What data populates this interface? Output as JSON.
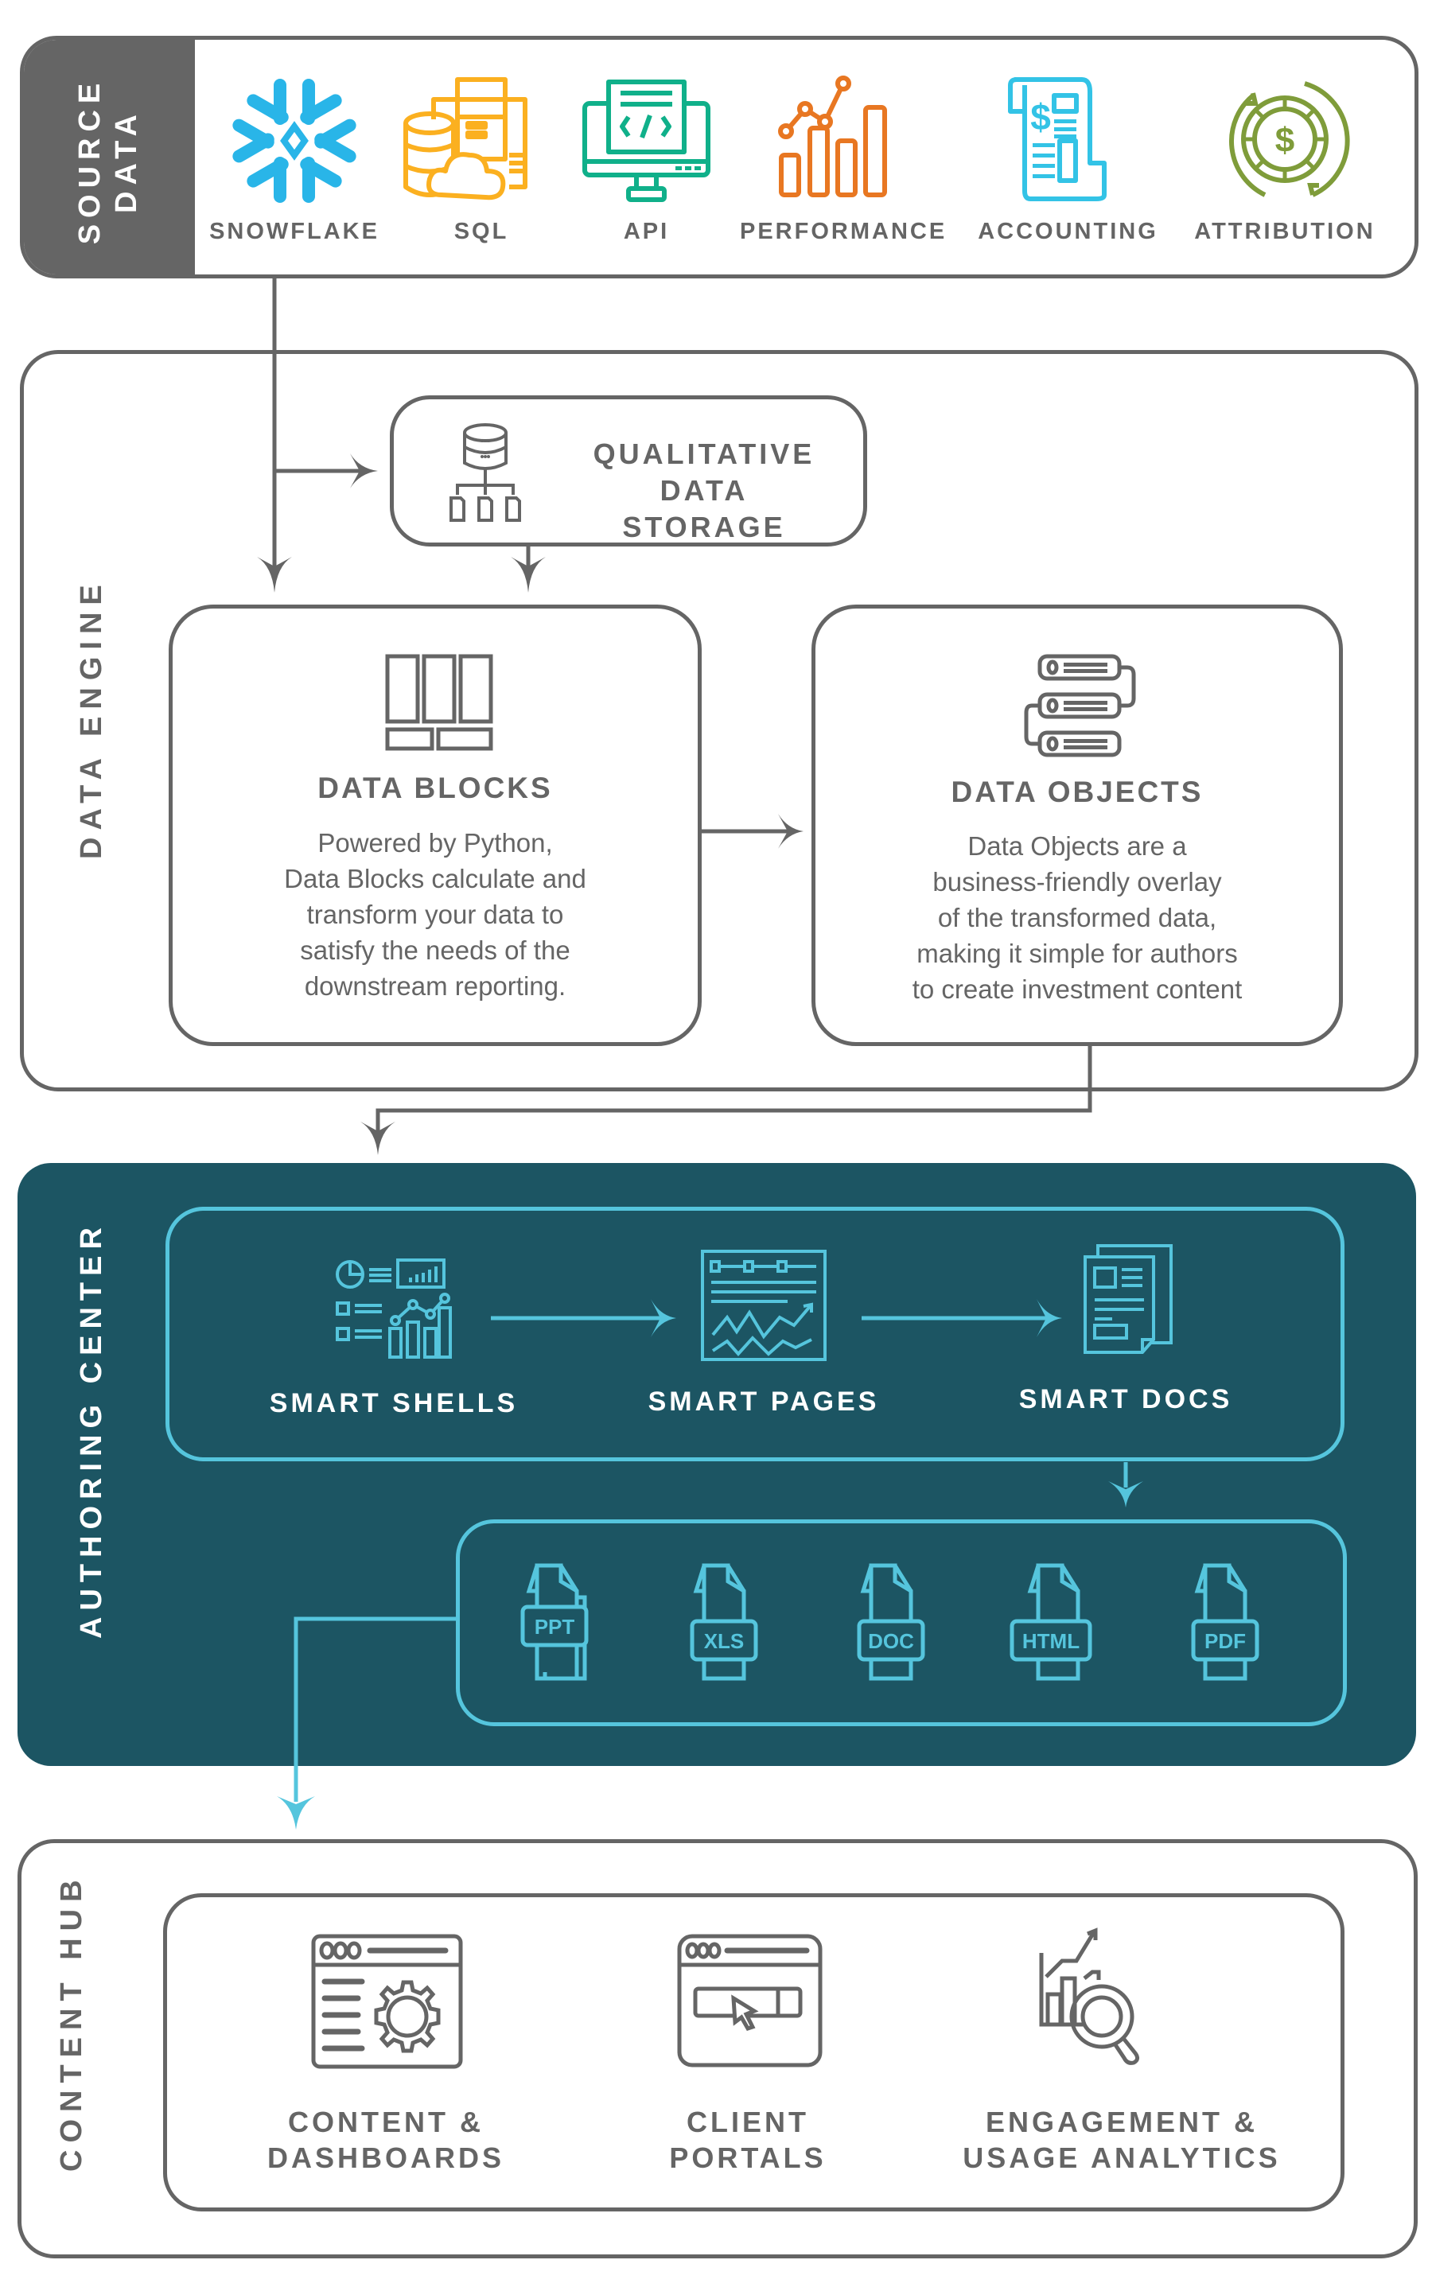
{
  "source_data": {
    "section_label_line1": "SOURCE",
    "section_label_line2": "DATA",
    "items": [
      {
        "label": "SNOWFLAKE",
        "icon": "snowflake-icon",
        "color": "#29b5e8"
      },
      {
        "label": "SQL",
        "icon": "database-cloud-icon",
        "color": "#fbb020"
      },
      {
        "label": "API",
        "icon": "monitor-code-icon",
        "color": "#10b08a"
      },
      {
        "label": "PERFORMANCE",
        "icon": "bar-line-chart-icon",
        "color": "#e87722"
      },
      {
        "label": "ACCOUNTING",
        "icon": "ledger-dollar-icon",
        "color": "#33c3e6"
      },
      {
        "label": "ATTRIBUTION",
        "icon": "dollar-cycle-icon",
        "color": "#7f9c3a"
      }
    ]
  },
  "data_engine": {
    "section_label": "DATA ENGINE",
    "storage": {
      "title_line1": "QUALITATIVE",
      "title_line2": "DATA STORAGE",
      "icon": "database-tree-icon"
    },
    "blocks": {
      "title": "DATA BLOCKS",
      "icon": "blocks-icon",
      "description": [
        "Powered by Python,",
        "Data Blocks calculate and",
        "transform your data to",
        "satisfy the needs of the",
        "downstream reporting."
      ]
    },
    "objects": {
      "title": "DATA OBJECTS",
      "icon": "server-stack-icon",
      "description": [
        "Data Objects are a",
        "business-friendly overlay",
        "of the transformed data,",
        "making it simple for authors",
        "to create investment content"
      ]
    }
  },
  "authoring_center": {
    "section_label": "AUTHORING CENTER",
    "background": "#1c5563",
    "accent": "#55c5dd",
    "steps": [
      {
        "label": "SMART SHELLS",
        "icon": "dashboard-widgets-icon"
      },
      {
        "label": "SMART PAGES",
        "icon": "page-chart-icon"
      },
      {
        "label": "SMART DOCS",
        "icon": "documents-icon"
      }
    ],
    "formats": [
      "PPT",
      "XLS",
      "DOC",
      "HTML",
      "PDF"
    ]
  },
  "content_hub": {
    "section_label": "CONTENT HUB",
    "items": [
      {
        "line1": "CONTENT &",
        "line2": "DASHBOARDS",
        "icon": "browser-gear-icon"
      },
      {
        "line1": "CLIENT",
        "line2": "PORTALS",
        "icon": "browser-click-icon"
      },
      {
        "line1": "ENGAGEMENT &",
        "line2": "USAGE ANALYTICS",
        "icon": "chart-magnifier-icon"
      }
    ]
  }
}
